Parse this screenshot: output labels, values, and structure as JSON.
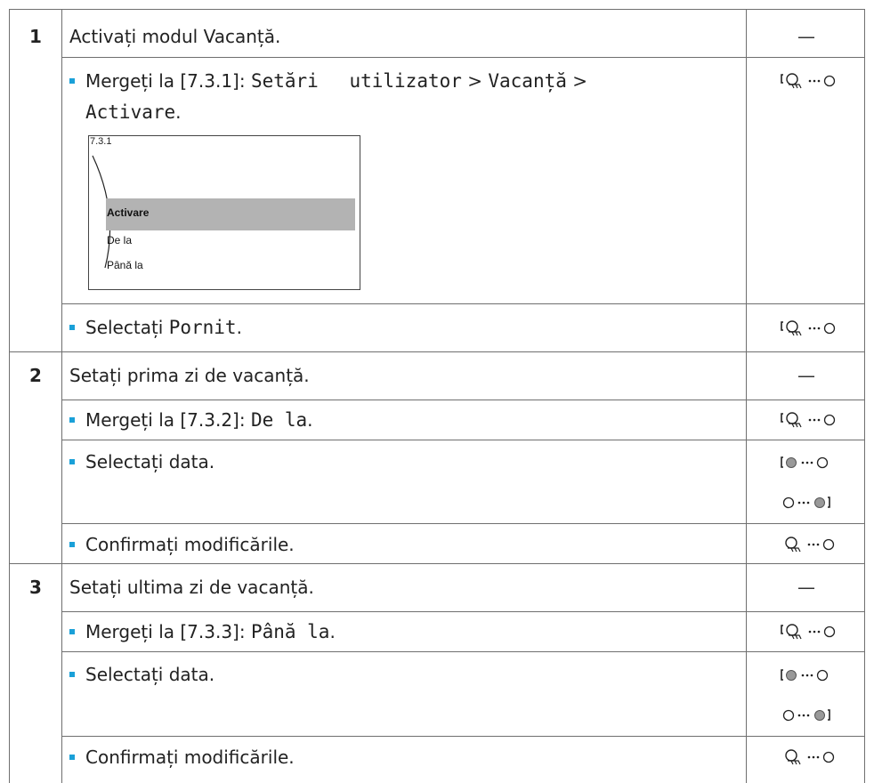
{
  "steps": [
    {
      "num": "1",
      "title": "Activați modul Vacanță.",
      "title_action": "—",
      "substeps": [
        {
          "pre": "Mergeți la [7.3.1]: ",
          "path1": "Setări utilizator",
          "sep1": " > ",
          "path2": "Vacanță",
          "sep2": " >",
          "path3": "Activare",
          "post": ".",
          "action_icon": "left-dial-turn-icon"
        },
        {
          "pre": "Selectați ",
          "code": "Pornit",
          "post": ".",
          "action_icon": "left-dial-turn-icon"
        }
      ],
      "screen": {
        "id": "7.3.1",
        "items": [
          "Activare",
          "De la",
          "Până la"
        ],
        "selected": "Activare"
      }
    },
    {
      "num": "2",
      "title": "Setați prima zi de vacanță.",
      "title_action": "—",
      "substeps": [
        {
          "pre": "Mergeți la [7.3.2]: ",
          "code": "De la",
          "post": ".",
          "action_icon": "left-dial-turn-icon"
        },
        {
          "pre": "Selectați data.",
          "action_icons": [
            "left-dial-turn-icon",
            "right-dial-turn-icon"
          ]
        },
        {
          "pre": "Confirmați modificările.",
          "action_icon": "left-dial-press-icon"
        }
      ]
    },
    {
      "num": "3",
      "title": "Setați ultima zi de vacanță.",
      "title_action": "—",
      "substeps": [
        {
          "pre": "Mergeți la [7.3.3]: ",
          "code": "Până la",
          "post": ".",
          "action_icon": "left-dial-turn-icon"
        },
        {
          "pre": "Selectați data.",
          "action_icons": [
            "left-dial-turn-icon",
            "right-dial-turn-icon"
          ]
        },
        {
          "pre": "Confirmați modificările.",
          "action_icon": "left-dial-press-icon"
        }
      ]
    }
  ],
  "colors": {
    "bullet": "#1aa0d8",
    "border": "#6f6f6f",
    "highlight": "#b3b3b3"
  }
}
